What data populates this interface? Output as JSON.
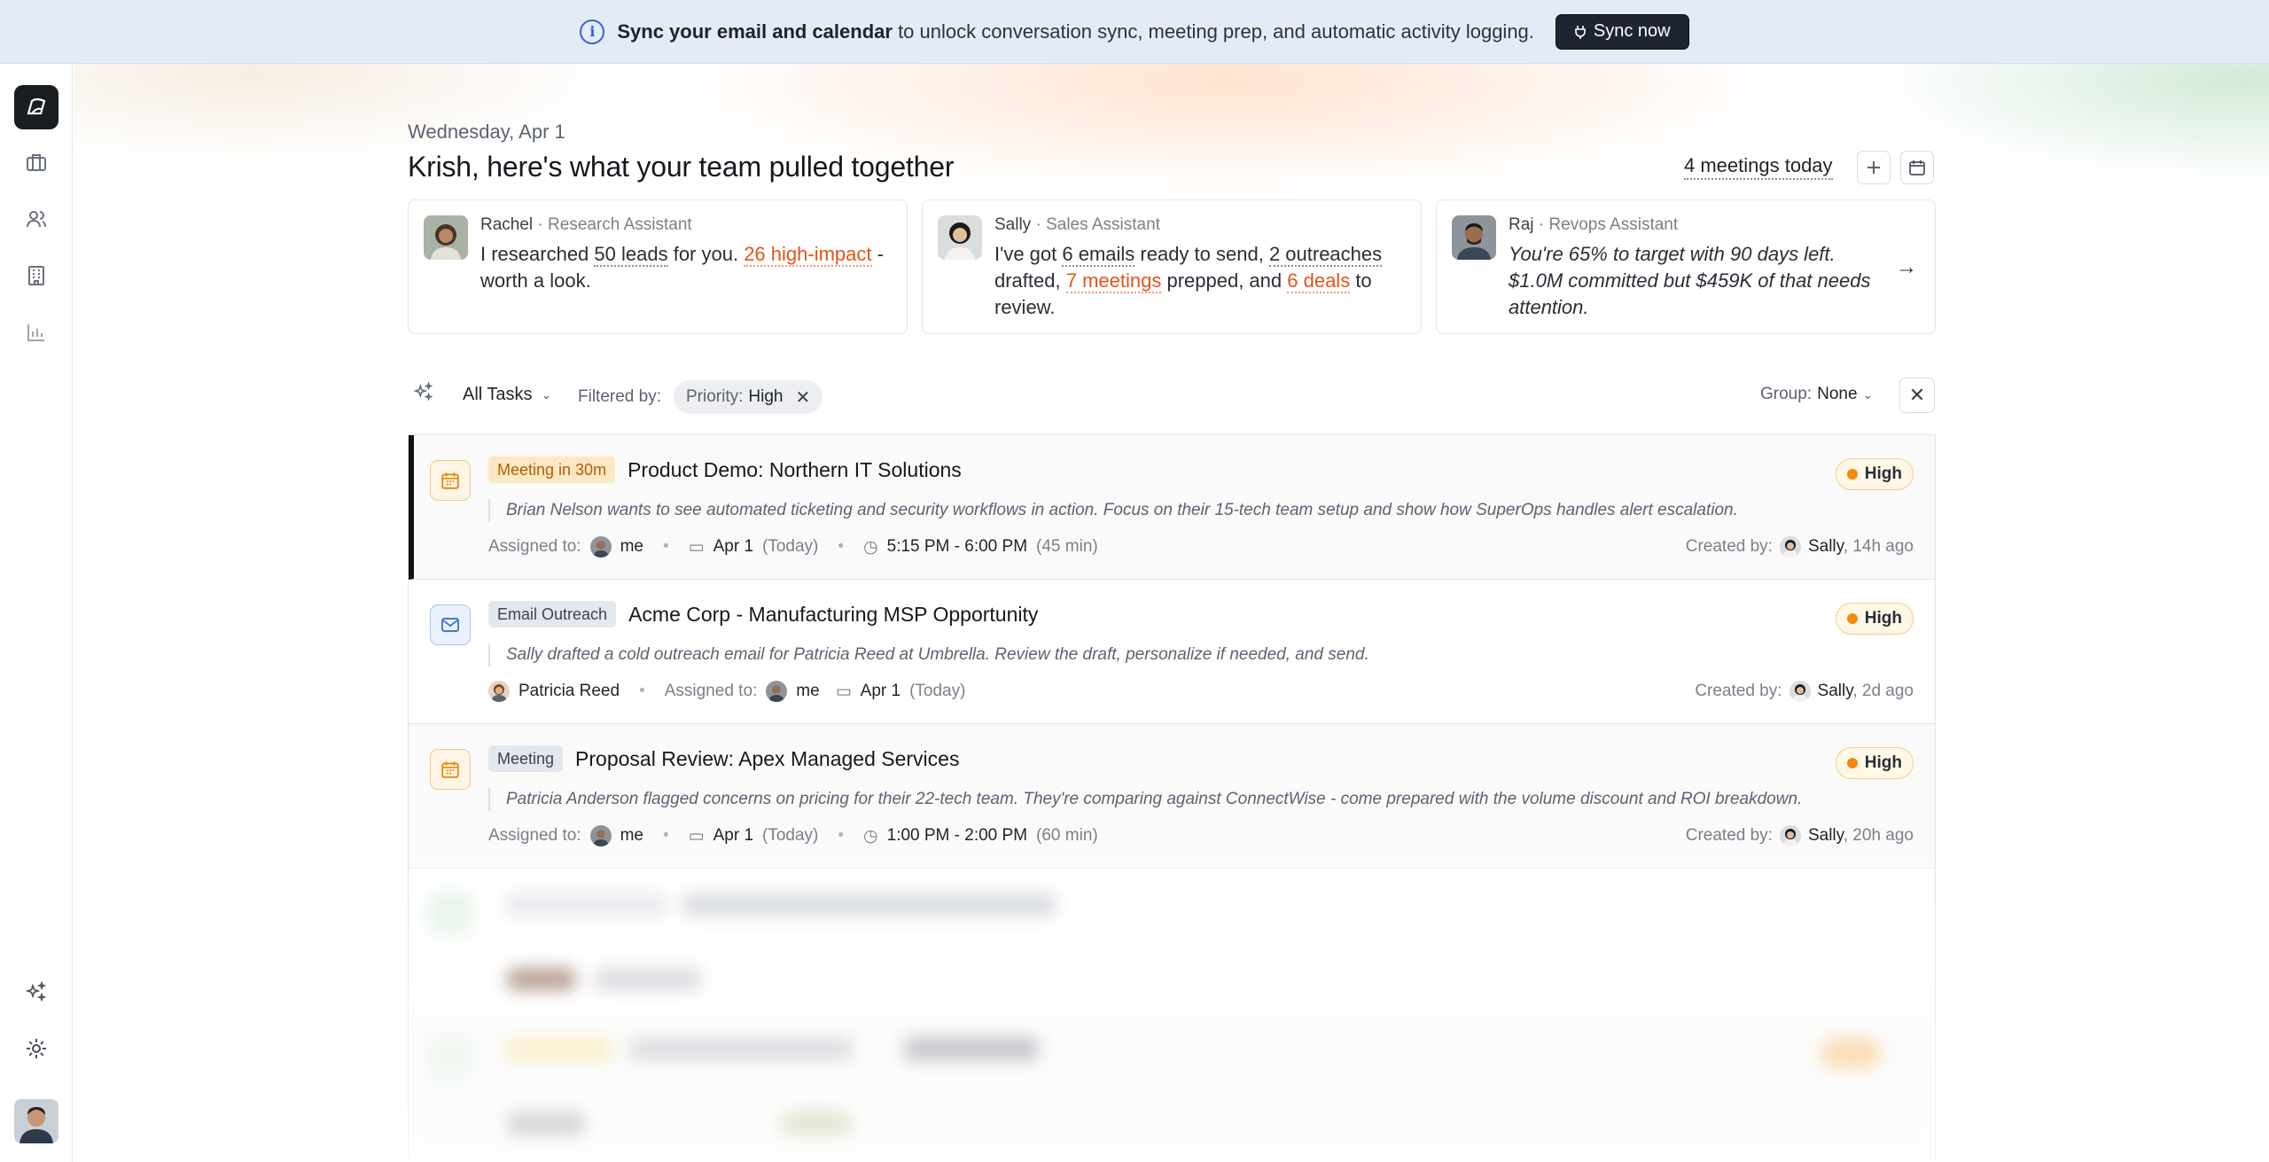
{
  "banner": {
    "bold_text": "Sync your email and calendar",
    "text": "to unlock conversation sync, meeting prep, and automatic activity logging.",
    "button": "Sync now"
  },
  "sidebar": {
    "items": [
      "logo",
      "briefcase-icon",
      "people-icon",
      "building-icon",
      "chart-icon",
      "sparkle-icon",
      "gear-icon",
      "avatar"
    ]
  },
  "header": {
    "date": "Wednesday, Apr 1",
    "title": "Krish, here's what your team pulled together",
    "meetings_link": "4 meetings today"
  },
  "assistants": [
    {
      "name": "Rachel",
      "role": "Research Assistant",
      "m1": "I researched ",
      "l1": "50 leads",
      "m2": " for you. ",
      "l2": "26 high-impact",
      "m3": " - worth a look."
    },
    {
      "name": "Sally",
      "role": "Sales Assistant",
      "m1": "I've got ",
      "l1": "6 emails",
      "m2": " ready to send, ",
      "l2": "2 outreaches",
      "m3": " drafted, ",
      "l3": "7 meetings",
      "m4": " prepped, and ",
      "l4": "6 deals",
      "m5": " to review."
    },
    {
      "name": "Raj",
      "role": "Revops Assistant",
      "message": "You're 65% to target with 90 days left. $1.0M committed but $459K of that needs attention."
    }
  ],
  "filters": {
    "view": "All Tasks",
    "filtered_by": "Filtered by:",
    "chip_key": "Priority:",
    "chip_value": "High",
    "group_label": "Group:",
    "group_value": "None"
  },
  "tasks": [
    {
      "tag": "Meeting in 30m",
      "title": "Product Demo: Northern IT Solutions",
      "priority": "High",
      "description": "Brian Nelson wants to see automated ticketing and security workflows in action. Focus on their 15-tech team setup and show how SuperOps handles alert escalation.",
      "assigned_label": "Assigned to:",
      "assignee": "me",
      "date": "Apr 1",
      "date_suffix": "(Today)",
      "time": "5:15 PM - 6:00 PM",
      "duration": "(45 min)",
      "created_label": "Created by:",
      "creator": "Sally",
      "created_ago": ", 14h ago"
    },
    {
      "tag": "Email Outreach",
      "title": "Acme Corp - Manufacturing MSP Opportunity",
      "priority": "High",
      "description": "Sally drafted a cold outreach email for Patricia Reed at Umbrella. Review the draft, personalize if needed, and send.",
      "contact": "Patricia Reed",
      "assigned_label": "Assigned to:",
      "assignee": "me",
      "date": "Apr 1",
      "date_suffix": "(Today)",
      "created_label": "Created by:",
      "creator": "Sally",
      "created_ago": ", 2d ago"
    },
    {
      "tag": "Meeting",
      "title": "Proposal Review: Apex Managed Services",
      "priority": "High",
      "description": "Patricia Anderson flagged concerns on pricing for their 22-tech team. They're comparing against ConnectWise - come prepared with the volume discount and ROI breakdown.",
      "assigned_label": "Assigned to:",
      "assignee": "me",
      "date": "Apr 1",
      "date_suffix": "(Today)",
      "time": "1:00 PM - 2:00 PM",
      "duration": "(60 min)",
      "created_label": "Created by:",
      "creator": "Sally",
      "created_ago": ", 20h ago"
    }
  ],
  "colors": {
    "banner_bg": "#e3ebf8",
    "accent_orange": "#e2541a",
    "priority_dot": "#f28a0b",
    "active_border": "#111111"
  }
}
